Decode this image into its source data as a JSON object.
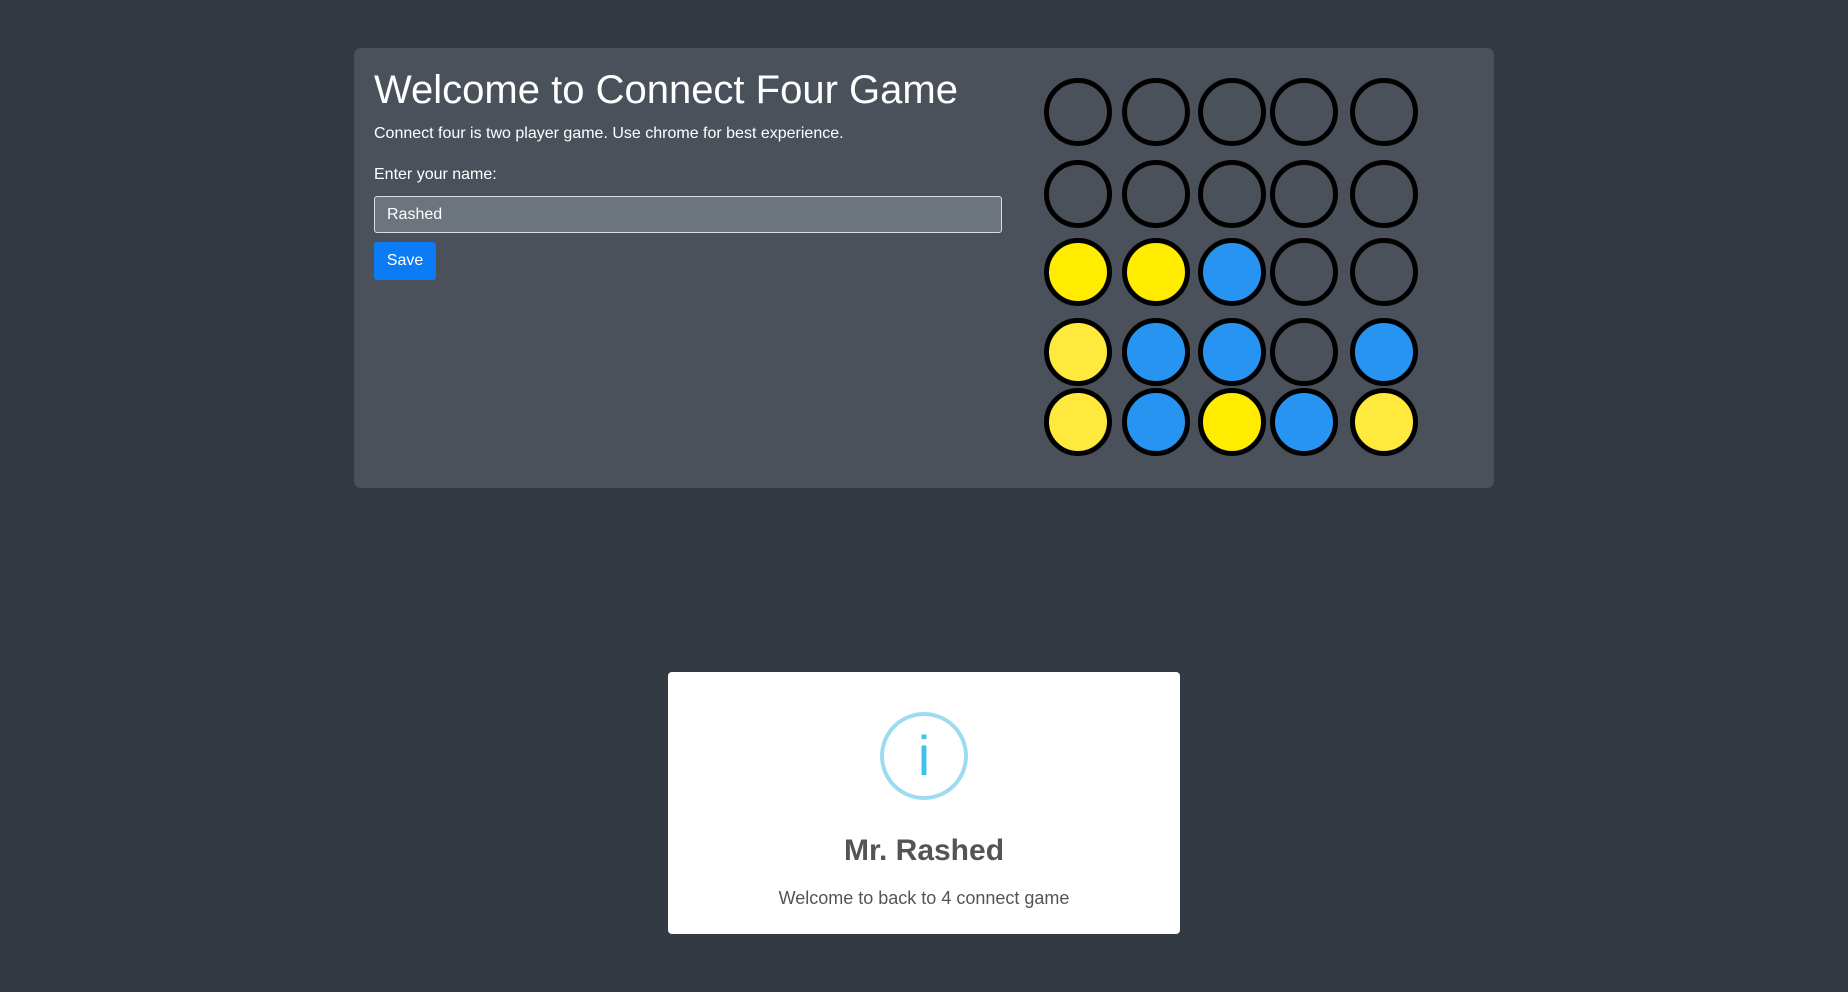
{
  "header": {
    "title": "Welcome to Connect Four Game",
    "subtitle": "Connect four is two player game. Use chrome for best experience."
  },
  "form": {
    "label": "Enter your name:",
    "name_value": "Rashed",
    "save_label": "Save"
  },
  "colors": {
    "yellow": "#ffec00",
    "yellow_light": "#ffe93c",
    "blue": "#2794f2",
    "empty_border": "#000000"
  },
  "board": {
    "columns": 5,
    "rows": [
      [
        "empty",
        "empty",
        "empty",
        "empty",
        "empty"
      ],
      [
        "empty",
        "empty",
        "empty",
        "empty",
        "empty"
      ],
      [
        "yellow",
        "yellow",
        "blue",
        "empty",
        "empty"
      ],
      [
        "yellow_light",
        "blue",
        "blue",
        "empty",
        "blue"
      ],
      [
        "yellow_light",
        "blue",
        "yellow",
        "blue",
        "yellow_light"
      ]
    ]
  },
  "modal": {
    "icon": "info-icon",
    "icon_glyph": "i",
    "title": "Mr. Rashed",
    "text": "Welcome to back to 4 connect game"
  }
}
